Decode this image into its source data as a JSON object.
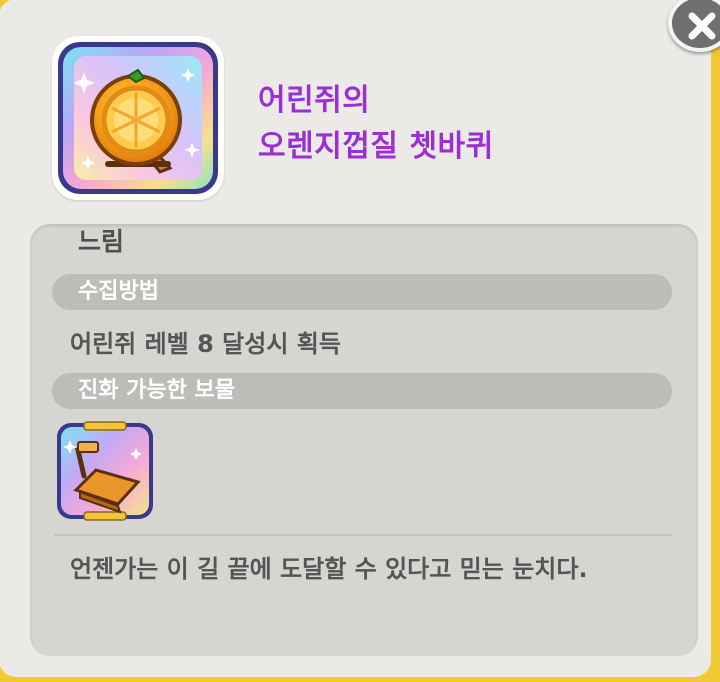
{
  "item": {
    "name_line1": "어린쥐의",
    "name_line2": "오렌지껍질 쳇바퀴",
    "icon": "orange-hamster-wheel-icon",
    "grade": "느림"
  },
  "sections": {
    "collect_method_header": "수집방법",
    "collect_method_text": "어린쥐 레벨 8 달성시 획득",
    "evolvable_header": "진화 가능한 보물",
    "evolvable_icon": "treadmill-icon"
  },
  "description": "언젠가는 이 길 끝에 도달할 수 있다고 믿는 눈치다.",
  "close_icon": "close-icon",
  "colors": {
    "title": "#9b2fd4",
    "frame_border": "#f1c933",
    "panel": "#d6d5d1",
    "section_bar": "#bdbcb8"
  }
}
